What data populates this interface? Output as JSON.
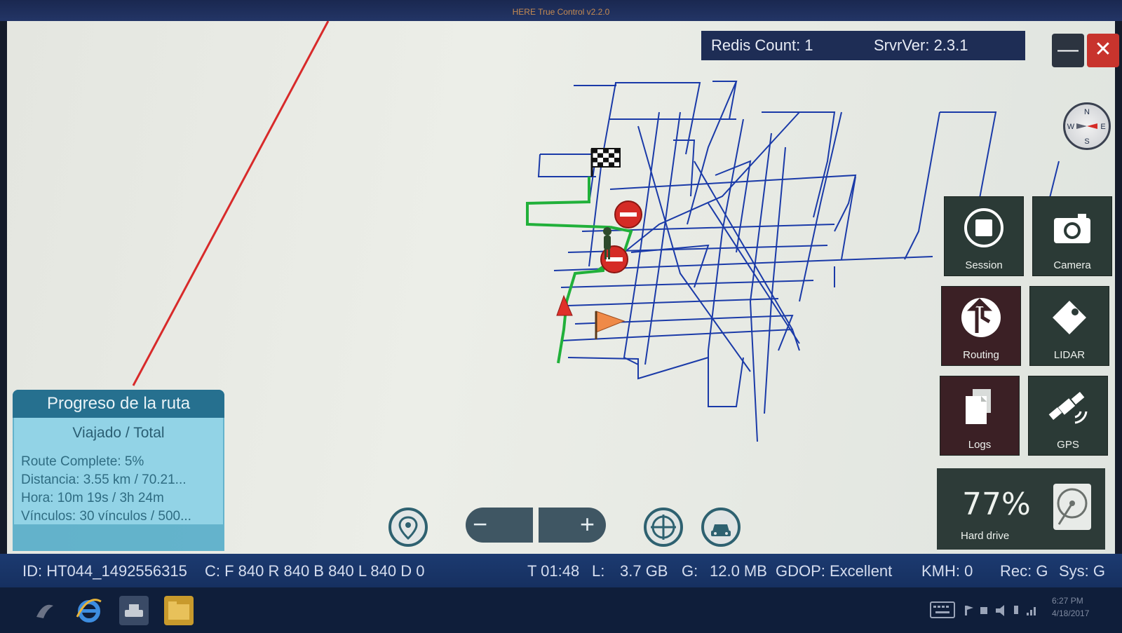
{
  "window": {
    "title": "HERE True Control v2.2.0"
  },
  "server": {
    "redis_count": "Redis Count: 1",
    "server_version": "SrvrVer: 2.3.1"
  },
  "window_controls": {
    "minimize_icon": "minimize-icon",
    "close_icon": "close-icon"
  },
  "compass": {
    "north": "N",
    "south": "S",
    "east": "E",
    "west": "W"
  },
  "tiles": {
    "session": "Session",
    "camera": "Camera",
    "routing": "Routing",
    "lidar": "LIDAR",
    "logs": "Logs",
    "gps": "GPS"
  },
  "hard_drive": {
    "percent": "77%",
    "label": "Hard drive"
  },
  "route_progress": {
    "title": "Progreso de la ruta",
    "subtitle": "Viajado / Total",
    "route_complete": "Route Complete: 5%",
    "distance": "Distancia: 3.55 km / 70.21...",
    "time": "Hora: 10m 19s / 3h 24m",
    "links": "Vínculos: 30 vínculos / 500..."
  },
  "map_controls": {
    "location_icon": "location-pin-icon",
    "zoom_out": "−",
    "zoom_in": "+",
    "center_icon": "crosshair-icon",
    "vehicle_icon": "car-follow-icon"
  },
  "status": {
    "id": "ID: HT044_1492556315",
    "counts": "C: F 840 R 840 B 840 L 840 D 0",
    "time": "T 01:48",
    "local": "L:",
    "local_value": "3.7 GB",
    "gps": "G:",
    "gps_value": "12.0 MB",
    "gdop": "GDOP: Excellent",
    "speed": "KMH: 0",
    "rec": "Rec: G",
    "sys": "Sys: G"
  },
  "taskbar": {
    "time": "6:27 PM",
    "date": "4/18/2017"
  },
  "colors": {
    "road": "#1a3aa8",
    "route": "#21b03a",
    "boundary": "#d82a2a",
    "panel_teal": "#26708f"
  }
}
